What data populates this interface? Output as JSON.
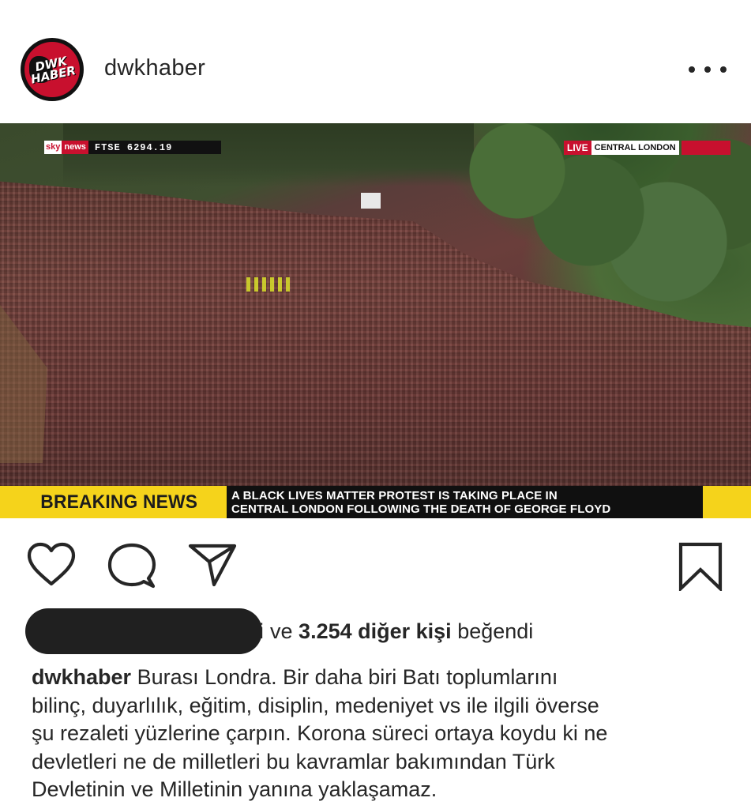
{
  "header": {
    "avatar_text": "DWK HABER",
    "username": "dwkhaber",
    "more_icon": "more-horizontal-icon"
  },
  "media": {
    "network_logo": "sky",
    "network_sub": "news",
    "ticker_text": "FTSE 6294.19",
    "live_label": "LIVE",
    "location_label": "CENTRAL LONDON",
    "breaking_label": "BREAKING NEWS",
    "breaking_lines": [
      "A BLACK LIVES MATTER PROTEST IS TAKING PLACE IN",
      "CENTRAL LONDON FOLLOWING THE DEATH OF GEORGE FLOYD"
    ],
    "colors": {
      "breaking_yellow": "#f5d31b",
      "sky_red": "#c8102e"
    }
  },
  "actions": {
    "like_icon": "heart-icon",
    "comment_icon": "comment-icon",
    "share_icon": "paper-plane-icon",
    "save_icon": "bookmark-icon"
  },
  "likes": {
    "sliver": "i",
    "prefix": "ve",
    "count": "3.254 diğer kişi",
    "suffix": "beğendi"
  },
  "caption": {
    "username": "dwkhaber",
    "lines": [
      "Burası Londra. Bir daha biri Batı toplumlarını",
      "bilinç, duyarlılık, eğitim, disiplin, medeniyet vs ile ilgili överse",
      "şu rezaleti yüzlerine çarpın. Korona süreci ortaya koydu ki ne",
      "devletleri ne de milletleri bu kavramlar bakımından Türk",
      "Devletinin ve Milletinin yanına yaklaşamaz."
    ]
  }
}
